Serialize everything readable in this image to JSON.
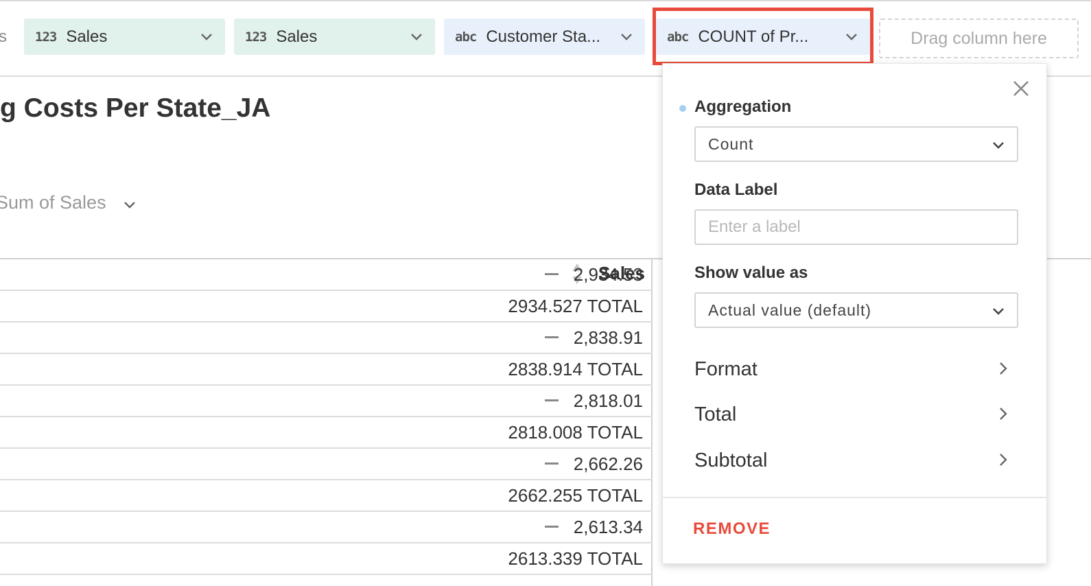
{
  "toolbar": {
    "left_glyph": "s",
    "pills": [
      {
        "tag": "123",
        "label": "Sales",
        "kind": "numeric"
      },
      {
        "tag": "123",
        "label": "Sales",
        "kind": "numeric"
      },
      {
        "tag": "abc",
        "label": "Customer Sta...",
        "kind": "text"
      },
      {
        "tag": "abc",
        "label": "COUNT of Pr...",
        "kind": "text"
      }
    ],
    "drop_zone": "Drag column here",
    "highlight_color": "#e84b3c"
  },
  "report": {
    "title": "g Costs Per State_JA",
    "metric_selector": "Sum of Sales"
  },
  "table": {
    "column_header": "Sales",
    "rows": [
      {
        "value": "2,934.53",
        "collapsible": true
      },
      {
        "value": "2934.527 TOTAL",
        "collapsible": false
      },
      {
        "value": "2,838.91",
        "collapsible": true
      },
      {
        "value": "2838.914 TOTAL",
        "collapsible": false
      },
      {
        "value": "2,818.01",
        "collapsible": true
      },
      {
        "value": "2818.008 TOTAL",
        "collapsible": false
      },
      {
        "value": "2,662.26",
        "collapsible": true
      },
      {
        "value": "2662.255 TOTAL",
        "collapsible": false
      },
      {
        "value": "2,613.34",
        "collapsible": true
      },
      {
        "value": "2613.339 TOTAL",
        "collapsible": false
      }
    ]
  },
  "panel": {
    "aggregation_label": "Aggregation",
    "aggregation_value": "Count",
    "data_label_label": "Data Label",
    "data_label_placeholder": "Enter a label",
    "show_value_label": "Show value as",
    "show_value_value": "Actual value (default)",
    "menu": [
      {
        "label": "Format"
      },
      {
        "label": "Total"
      },
      {
        "label": "Subtotal"
      }
    ],
    "remove_label": "REMOVE",
    "accent_color": "#e84b3c",
    "dot_color": "#a7cfee"
  }
}
